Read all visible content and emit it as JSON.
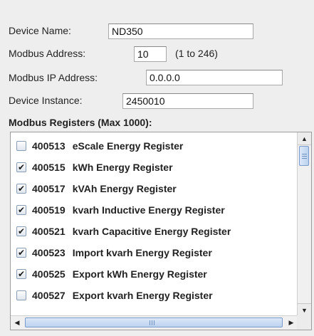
{
  "form": {
    "device_name_label": "Device Name:",
    "device_name_value": "ND350",
    "modbus_address_label": "Modbus Address:",
    "modbus_address_value": "10",
    "modbus_address_hint": "(1 to 246)",
    "modbus_ip_label": "Modbus IP Address:",
    "modbus_ip_value": "0.0.0.0",
    "device_instance_label": "Device Instance:",
    "device_instance_value": "2450010"
  },
  "registers": {
    "title": "Modbus Registers (Max 1000):",
    "items": [
      {
        "address": "400513",
        "name": "eScale Energy Register",
        "checked": false
      },
      {
        "address": "400515",
        "name": "kWh Energy Register",
        "checked": true
      },
      {
        "address": "400517",
        "name": "kVAh Energy Register",
        "checked": true
      },
      {
        "address": "400519",
        "name": "kvarh Inductive Energy Register",
        "checked": true
      },
      {
        "address": "400521",
        "name": "kvarh Capacitive Energy Register",
        "checked": true
      },
      {
        "address": "400523",
        "name": "Import kvarh Energy Register",
        "checked": true
      },
      {
        "address": "400525",
        "name": "Export kWh Energy Register",
        "checked": true
      },
      {
        "address": "400527",
        "name": "Export kvarh Energy Register",
        "checked": false
      }
    ]
  },
  "icons": {
    "checkmark": "✔",
    "scroll_up": "▲",
    "scroll_down": "▼",
    "scroll_left": "◀",
    "scroll_right": "▶"
  }
}
